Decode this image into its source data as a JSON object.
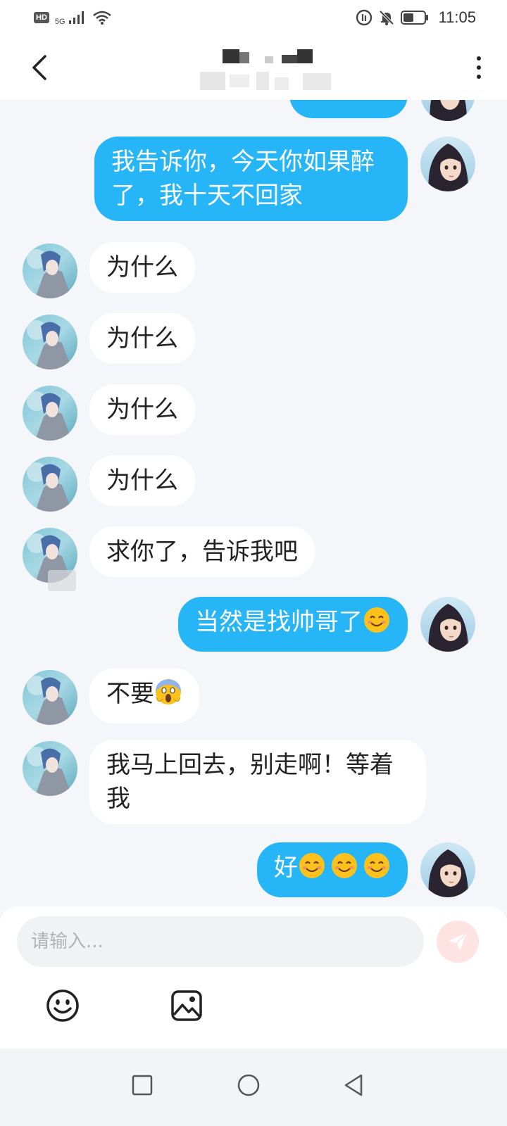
{
  "status_bar": {
    "hd_label": "HD",
    "network_label": "5G",
    "time": "11:05",
    "icons": [
      "hd-icon",
      "signal-icon",
      "wifi-icon",
      "sync-icon",
      "mute-bell-icon",
      "battery-icon"
    ]
  },
  "header": {
    "title": "",
    "back_icon": "chevron-left-icon",
    "more_icon": "more-vertical-icon"
  },
  "messages": [
    {
      "side": "me",
      "text": "我告诉你，今天你如果醉了，我十天不回家"
    },
    {
      "side": "other",
      "text": "为什么"
    },
    {
      "side": "other",
      "text": "为什么"
    },
    {
      "side": "other",
      "text": "为什么"
    },
    {
      "side": "other",
      "text": "为什么"
    },
    {
      "side": "other",
      "text": "求你了，告诉我吧"
    },
    {
      "side": "me",
      "text": "当然是找帅哥了",
      "emoji": [
        "smiling-face"
      ]
    },
    {
      "side": "other",
      "text": "不要",
      "emoji": [
        "screaming-face"
      ]
    },
    {
      "side": "other",
      "text": "我马上回去，别走啊！等着我"
    },
    {
      "side": "me",
      "text": "好",
      "emoji": [
        "smiling-face",
        "smiling-face",
        "smiling-face"
      ]
    }
  ],
  "input": {
    "placeholder": "请输入...",
    "value": ""
  },
  "toolbar": {
    "emoji_icon": "smiley-icon",
    "image_icon": "image-icon",
    "send_icon": "send-icon"
  },
  "colors": {
    "my_bubble": "#26b5f7",
    "other_bubble": "#ffffff",
    "background": "#f4f6f9",
    "send_button": "#fde3e2"
  }
}
